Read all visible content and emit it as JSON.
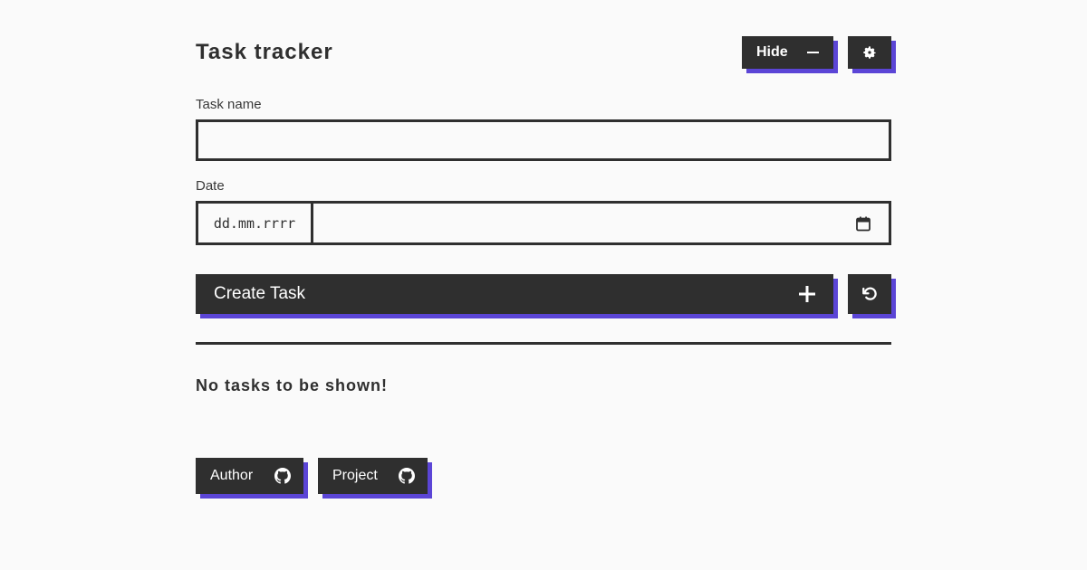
{
  "header": {
    "title": "Task tracker",
    "hide_label": "Hide",
    "theme_icon": "gear-icon"
  },
  "form": {
    "name_label": "Task name",
    "name_value": "",
    "date_label": "Date",
    "date_placeholder": "dd.mm.rrrr",
    "create_label": "Create Task"
  },
  "tasks": {
    "empty_message": "No tasks to be shown!"
  },
  "footer": {
    "author_label": "Author",
    "project_label": "Project"
  },
  "colors": {
    "primary": "#2f2f2f",
    "accent_shadow": "#5b45d6",
    "background": "#fafafa"
  }
}
